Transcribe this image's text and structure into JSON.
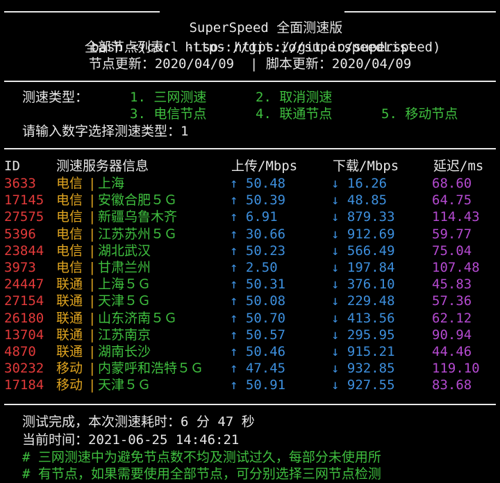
{
  "header": {
    "title": "SuperSpeed 全面测速版",
    "command": "bash <(curl -Lso- https://git.io/superspeed)",
    "list_label": "全部节点列表：",
    "list_url": "https://git.io/superspeedList",
    "node_update_label": "节点更新：",
    "node_update_date": "2020/04/09",
    "divider": "|",
    "script_update_label": "脚本更新：",
    "script_update_date": "2020/04/09"
  },
  "menu": {
    "type_label": "测速类型：",
    "options": [
      "1. 三网测速",
      "2. 取消测速",
      "3. 电信节点",
      "4. 联通节点",
      "5. 移动节点"
    ],
    "prompt": "请输入数字选择测速类型：",
    "selected": "1"
  },
  "table": {
    "columns": [
      "ID",
      "测速服务器信息",
      "上传/Mbps",
      "下载/Mbps",
      "延迟/ms"
    ],
    "rows": [
      {
        "id": "3633",
        "isp": "电信",
        "loc": "上海",
        "up": "↑ 50.48",
        "down": "↓ 16.26",
        "ping": "68.60"
      },
      {
        "id": "17145",
        "isp": "电信",
        "loc": "安徽合肥５Ｇ",
        "up": "↑ 50.39",
        "down": "↓ 48.85",
        "ping": "64.75"
      },
      {
        "id": "27575",
        "isp": "电信",
        "loc": "新疆乌鲁木齐",
        "up": "↑ 6.91",
        "down": "↓ 879.33",
        "ping": "114.43"
      },
      {
        "id": "5396",
        "isp": "电信",
        "loc": "江苏苏州５Ｇ",
        "up": "↑ 30.66",
        "down": "↓ 912.69",
        "ping": "59.77"
      },
      {
        "id": "23844",
        "isp": "电信",
        "loc": "湖北武汉",
        "up": "↑ 50.23",
        "down": "↓ 566.49",
        "ping": "75.04"
      },
      {
        "id": "3973",
        "isp": "电信",
        "loc": "甘肃兰州",
        "up": "↑ 2.50",
        "down": "↓ 197.84",
        "ping": "107.48"
      },
      {
        "id": "24447",
        "isp": "联通",
        "loc": "上海５Ｇ",
        "up": "↑ 50.31",
        "down": "↓ 376.10",
        "ping": "45.83"
      },
      {
        "id": "27154",
        "isp": "联通",
        "loc": "天津５Ｇ",
        "up": "↑ 50.08",
        "down": "↓ 229.48",
        "ping": "57.36"
      },
      {
        "id": "26180",
        "isp": "联通",
        "loc": "山东济南５Ｇ",
        "up": "↑ 50.70",
        "down": "↓ 413.56",
        "ping": "62.12"
      },
      {
        "id": "13704",
        "isp": "联通",
        "loc": "江苏南京",
        "up": "↑ 50.57",
        "down": "↓ 295.95",
        "ping": "90.94"
      },
      {
        "id": "4870",
        "isp": "联通",
        "loc": "湖南长沙",
        "up": "↑ 50.46",
        "down": "↓ 915.21",
        "ping": "44.46"
      },
      {
        "id": "30232",
        "isp": "移动",
        "loc": "内蒙呼和浩特５Ｇ",
        "up": "↑ 47.45",
        "down": "↓ 932.85",
        "ping": "119.10"
      },
      {
        "id": "17184",
        "isp": "移动",
        "loc": "天津５Ｇ",
        "up": "↑ 50.91",
        "down": "↓ 927.55",
        "ping": "83.68"
      }
    ]
  },
  "footer": {
    "done_text": "测试完成，本次测速耗时：",
    "minutes": "6",
    "minutes_unit": "分",
    "seconds": "47",
    "seconds_unit": "秒",
    "time_label": "当前时间：",
    "time_value": "2021-06-25 14:46:21",
    "note1": "# 三网测速中为避免节点数不均及测试过久，每部分未使用所",
    "note2": "# 有节点，如果需要使用全部节点，可分别选择三网节点检测"
  },
  "colors": {
    "background": "#000000",
    "text": "#e8e8e8",
    "green": "#3fbf3f",
    "red": "#e23a3a",
    "yellow": "#e0a520",
    "blue": "#3d8fdd",
    "purple": "#b44ad0"
  }
}
